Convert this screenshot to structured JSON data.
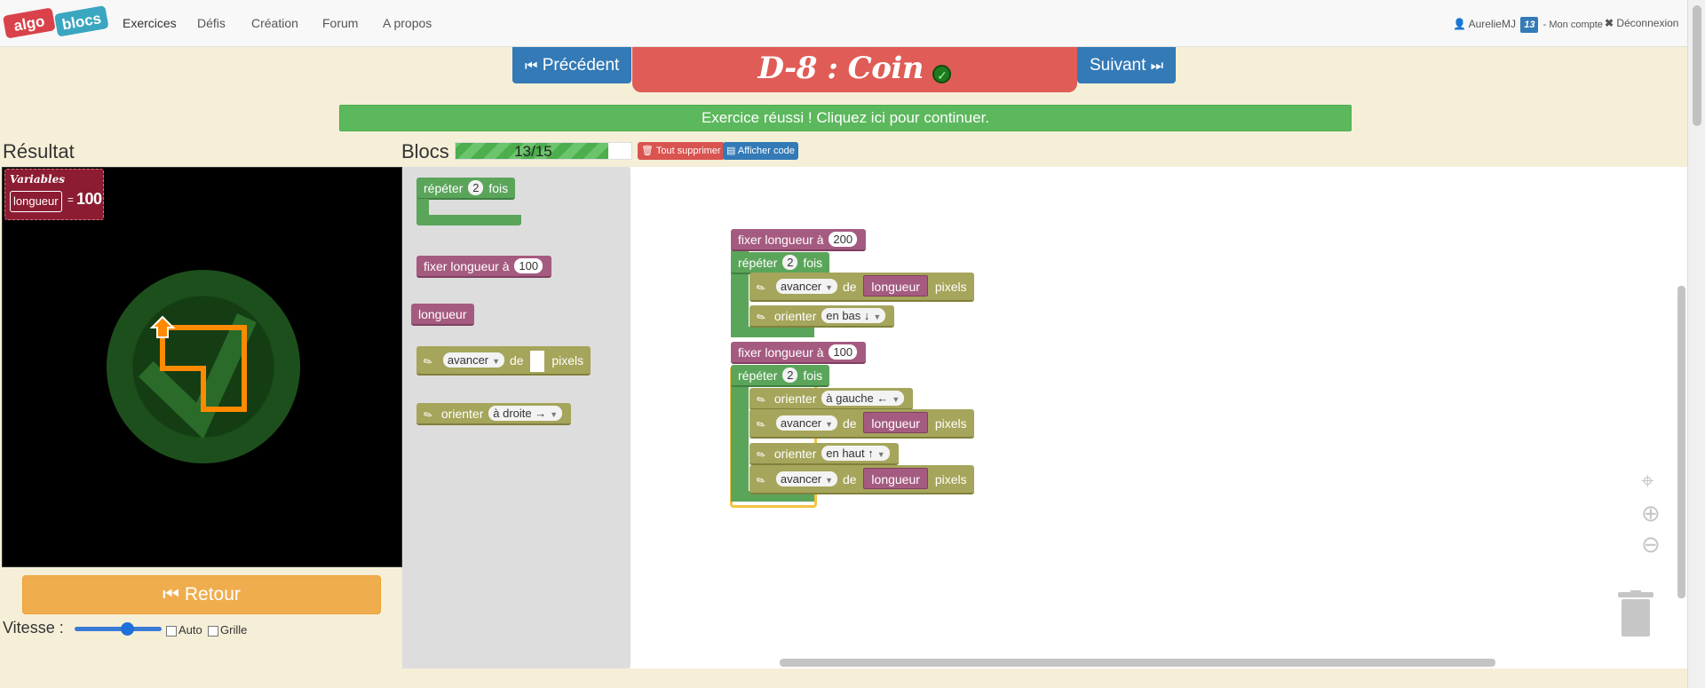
{
  "navbar": {
    "logo_left": "algo",
    "logo_right": "blocs",
    "links": [
      "Exercices",
      "Défis",
      "Création",
      "Forum",
      "A propos"
    ],
    "user": "AurelieMJ",
    "badge": "13",
    "account": "- Mon compte",
    "logout": "Déconnexion"
  },
  "header": {
    "prev": "Précédent",
    "next": "Suivant",
    "title": "D-8 : Coin",
    "success": "Exercice réussi ! Cliquez ici pour continuer."
  },
  "result": {
    "title": "Résultat",
    "vars_title": "Variables",
    "var_name": "longueur",
    "var_equals": "=",
    "var_value": "100"
  },
  "controls": {
    "retour": "Retour",
    "speed_label": "Vitesse :",
    "speed_value": 0.58,
    "auto": "Auto",
    "grille": "Grille"
  },
  "blocs": {
    "title": "Blocs",
    "progress_text": "13/15",
    "progress_value": 0.867,
    "delete_all": "Tout supprimer",
    "show_code": "Afficher code"
  },
  "toolbox": {
    "repeat_pre": "répéter",
    "repeat_n": "2",
    "repeat_post": "fois",
    "set_label": "fixer longueur à",
    "set_value": "100",
    "var_label": "longueur",
    "forward_label": "avancer",
    "forward_de": "de",
    "forward_pixels": "pixels",
    "orient_label": "orienter",
    "orient_value": "à droite →"
  },
  "program": {
    "set1_label": "fixer longueur à",
    "set1_value": "200",
    "rep1_pre": "répéter",
    "rep1_n": "2",
    "rep1_post": "fois",
    "fwd_label": "avancer",
    "fwd_de": "de",
    "fwd_var": "longueur",
    "fwd_pixels": "pixels",
    "orient_label": "orienter",
    "orient_down": "en bas ↓",
    "set2_label": "fixer longueur à",
    "set2_value": "100",
    "rep2_pre": "répéter",
    "rep2_n": "2",
    "rep2_post": "fois",
    "orient_left": "à gauche ←",
    "orient_up": "en haut ↑"
  },
  "colors": {
    "primary": "#337ab7",
    "danger": "#e05c57",
    "success": "#5cb85c",
    "warning": "#f0ad4e",
    "block_pink": "#a55b80",
    "block_green": "#5ba55b",
    "block_olive": "#a5a55b"
  }
}
